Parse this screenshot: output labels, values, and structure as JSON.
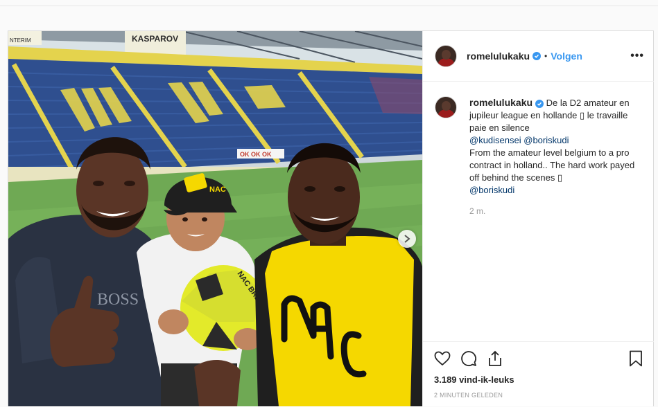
{
  "post": {
    "username": "romelulukaku",
    "follow_label": "Volgen",
    "separator": "•",
    "more_label": "•••",
    "caption": {
      "part1": "De la D2 amateur en jupileur league en hollande ▯ le travaille paie en silence",
      "mention1": "@kudisensei",
      "mention2": "@boriskudi",
      "part2": "From the amateur level belgium to a pro contract in holland.. The hard work payed off behind the scenes ▯",
      "mention3": "@boriskudi"
    },
    "time_short": "2 m.",
    "likes": "3.189 vind-ik-leuks",
    "time_ago": "2 MINUTEN GELEDEN"
  },
  "photo": {
    "banner_text": "KASPAROV",
    "banner_left": "NTERIM",
    "board_text": "OK OK OK",
    "cap_text": "NAC",
    "ball_text": "NAC BREDA",
    "shirt_text": "BOSS"
  },
  "colors": {
    "link": "#3897f0",
    "mention": "#003569",
    "seat_blue": "#2f4f8f",
    "nac_yellow": "#f5d800"
  }
}
